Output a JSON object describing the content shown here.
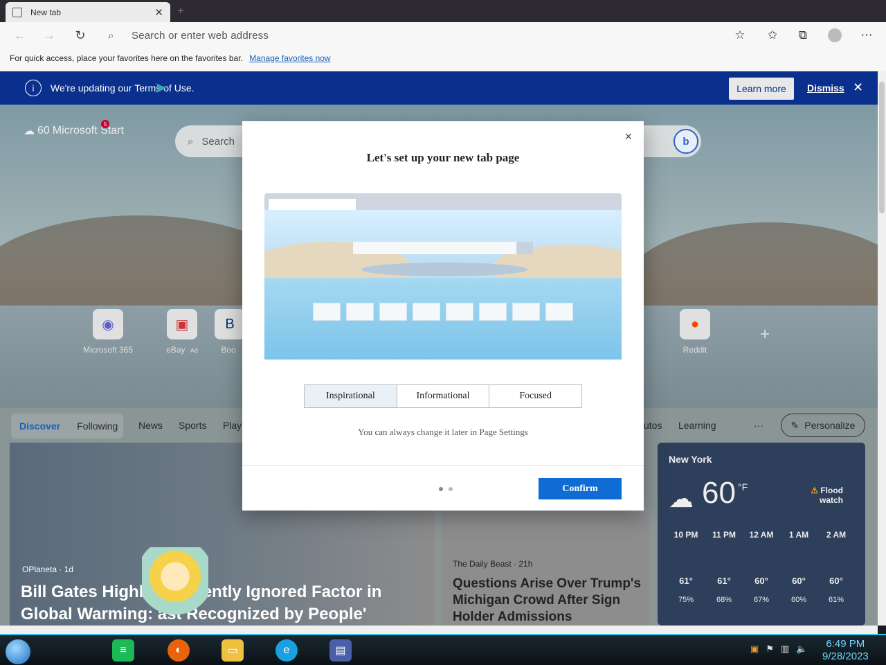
{
  "browser": {
    "tab_title": "New tab",
    "address_placeholder": "Search or enter web address",
    "favorites_hint": "For quick access, place your favorites here on the favorites bar.",
    "favorites_link": "Manage favorites now"
  },
  "banner": {
    "message": "We're updating our Terms of Use.",
    "learn_more": "Learn more",
    "dismiss": "Dismiss"
  },
  "newtab": {
    "temperature_small": "60",
    "brand": "Microsoft Start",
    "notif_count": "5",
    "search_placeholder": "Search",
    "tiles": [
      {
        "label": "Microsoft 365"
      },
      {
        "label": "eBay",
        "ad": "Ad"
      },
      {
        "label": "Boo"
      },
      {
        "label": "Reddit"
      }
    ],
    "nav": {
      "discover": "Discover",
      "following": "Following",
      "news": "News",
      "sports": "Sports",
      "play": "Play",
      "autos": "utos",
      "learning": "Learning",
      "more": "···",
      "personalize": "Personalize"
    },
    "main_card": {
      "source": "OPlaneta · 1d",
      "headline_a": "Bill Gates Highligh",
      "headline_b": "equently Ignored Factor in",
      "headline_c": "Global Warming: ",
      "headline_d": "ast Recognized by People'"
    },
    "mid_card": {
      "source": "The Daily Beast · 21h",
      "headline": "Questions Arise Over Trump's Michigan Crowd After Sign Holder Admissions"
    },
    "weather": {
      "city": "New York",
      "temp": "60",
      "unit": "°F",
      "alert_line1": "Flood",
      "alert_line2": "watch",
      "hours": [
        {
          "time": "10 PM",
          "temp": "61°",
          "precip": "75%"
        },
        {
          "time": "11 PM",
          "temp": "61°",
          "precip": "68%"
        },
        {
          "time": "12 AM",
          "temp": "60°",
          "precip": "67%"
        },
        {
          "time": "1 AM",
          "temp": "60°",
          "precip": "60%"
        },
        {
          "time": "2 AM",
          "temp": "60°",
          "precip": "61%"
        }
      ]
    }
  },
  "dialog": {
    "title": "Let's set up your new tab page",
    "options": [
      "Inspirational",
      "Informational",
      "Focused"
    ],
    "selected": "Inspirational",
    "hint": "You can always change it later in Page Settings",
    "confirm": "Confirm"
  },
  "taskbar": {
    "time": "6:49 PM",
    "date": "9/28/2023"
  }
}
